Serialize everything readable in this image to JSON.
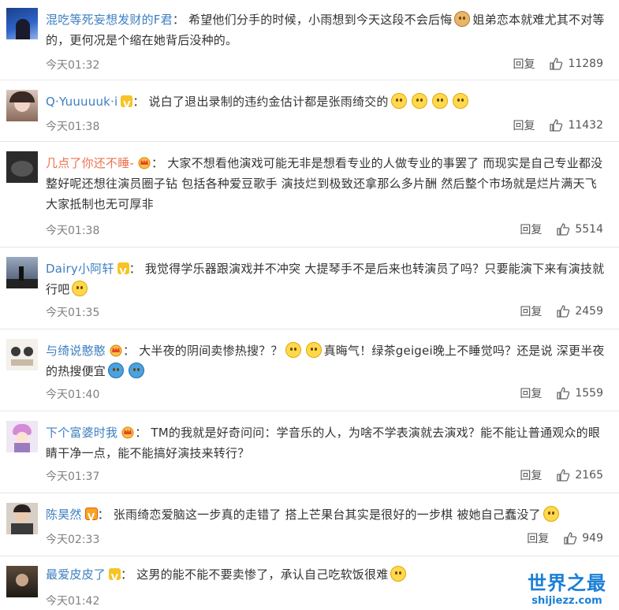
{
  "comments": [
    {
      "username": "混吃等死妄想发财的F君",
      "separator": "：",
      "text_parts": [
        "希望他们分手的时候，小雨想到今天这段不会后悔",
        "姐弟恋本就难尤其不对等的，更何况是个缩在她背后没种的。"
      ],
      "time": "今天01:32",
      "reply_label": "回复",
      "likes": "11289"
    },
    {
      "username": "Q·Yuuuuuk·i",
      "separator": "：",
      "text_parts": [
        "说白了退出录制的违约金估计都是张雨绮交的"
      ],
      "time": "今天01:38",
      "reply_label": "回复",
      "likes": "11432"
    },
    {
      "username": "几点了你还不睡-",
      "separator": "：",
      "text_parts": [
        "大家不想看他演戏可能无非是想看专业的人做专业的事罢了 而现实是自己专业都没整好呢还想往演员圈子钻 包括各种爱豆歌手 演技烂到极致还拿那么多片酬 然后整个市场就是烂片满天飞 大家抵制也无可厚非"
      ],
      "time": "今天01:38",
      "reply_label": "回复",
      "likes": "5514"
    },
    {
      "username": "Dairy小阿轩",
      "separator": "：",
      "text_parts": [
        "我觉得学乐器跟演戏并不冲突 大提琴手不是后来也转演员了吗？只要能演下来有演技就行吧"
      ],
      "time": "今天01:35",
      "reply_label": "回复",
      "likes": "2459"
    },
    {
      "username": "与绮说憨憨",
      "separator": "：",
      "text_parts": [
        "大半夜的阴间卖惨热搜？？",
        "真晦气！绿茶geigei晚上不睡觉吗？还是说 深更半夜的热搜便宜"
      ],
      "time": "今天01:40",
      "reply_label": "回复",
      "likes": "1559"
    },
    {
      "username": "下个富婆时我",
      "separator": "：",
      "text_parts": [
        "TM的我就是好奇问问：学音乐的人，为啥不学表演就去演戏？能不能让普通观众的眼睛干净一点，能不能搞好演技来转行？"
      ],
      "time": "今天01:37",
      "reply_label": "回复",
      "likes": "2165"
    },
    {
      "username": "陈昊然",
      "separator": "：",
      "text_parts": [
        "张雨绮恋爱脑这一步真的走错了 搭上芒果台其实是很好的一步棋 被她自己蠢没了"
      ],
      "time": "今天02:33",
      "reply_label": "回复",
      "likes": "949"
    },
    {
      "username": "最爱皮皮了",
      "separator": "：",
      "text_parts": [
        "这男的能不能不要卖惨了，承认自己吃软饭很难"
      ],
      "time": "今天01:42",
      "reply_label": "回复",
      "likes": ""
    }
  ],
  "watermark": {
    "title": "世界之最",
    "url": "shijiezz.com"
  },
  "colors": {
    "username": "#eb7350",
    "username_alt": "#3d7fc1",
    "meta": "#808080",
    "divider": "#e6e6e6"
  }
}
